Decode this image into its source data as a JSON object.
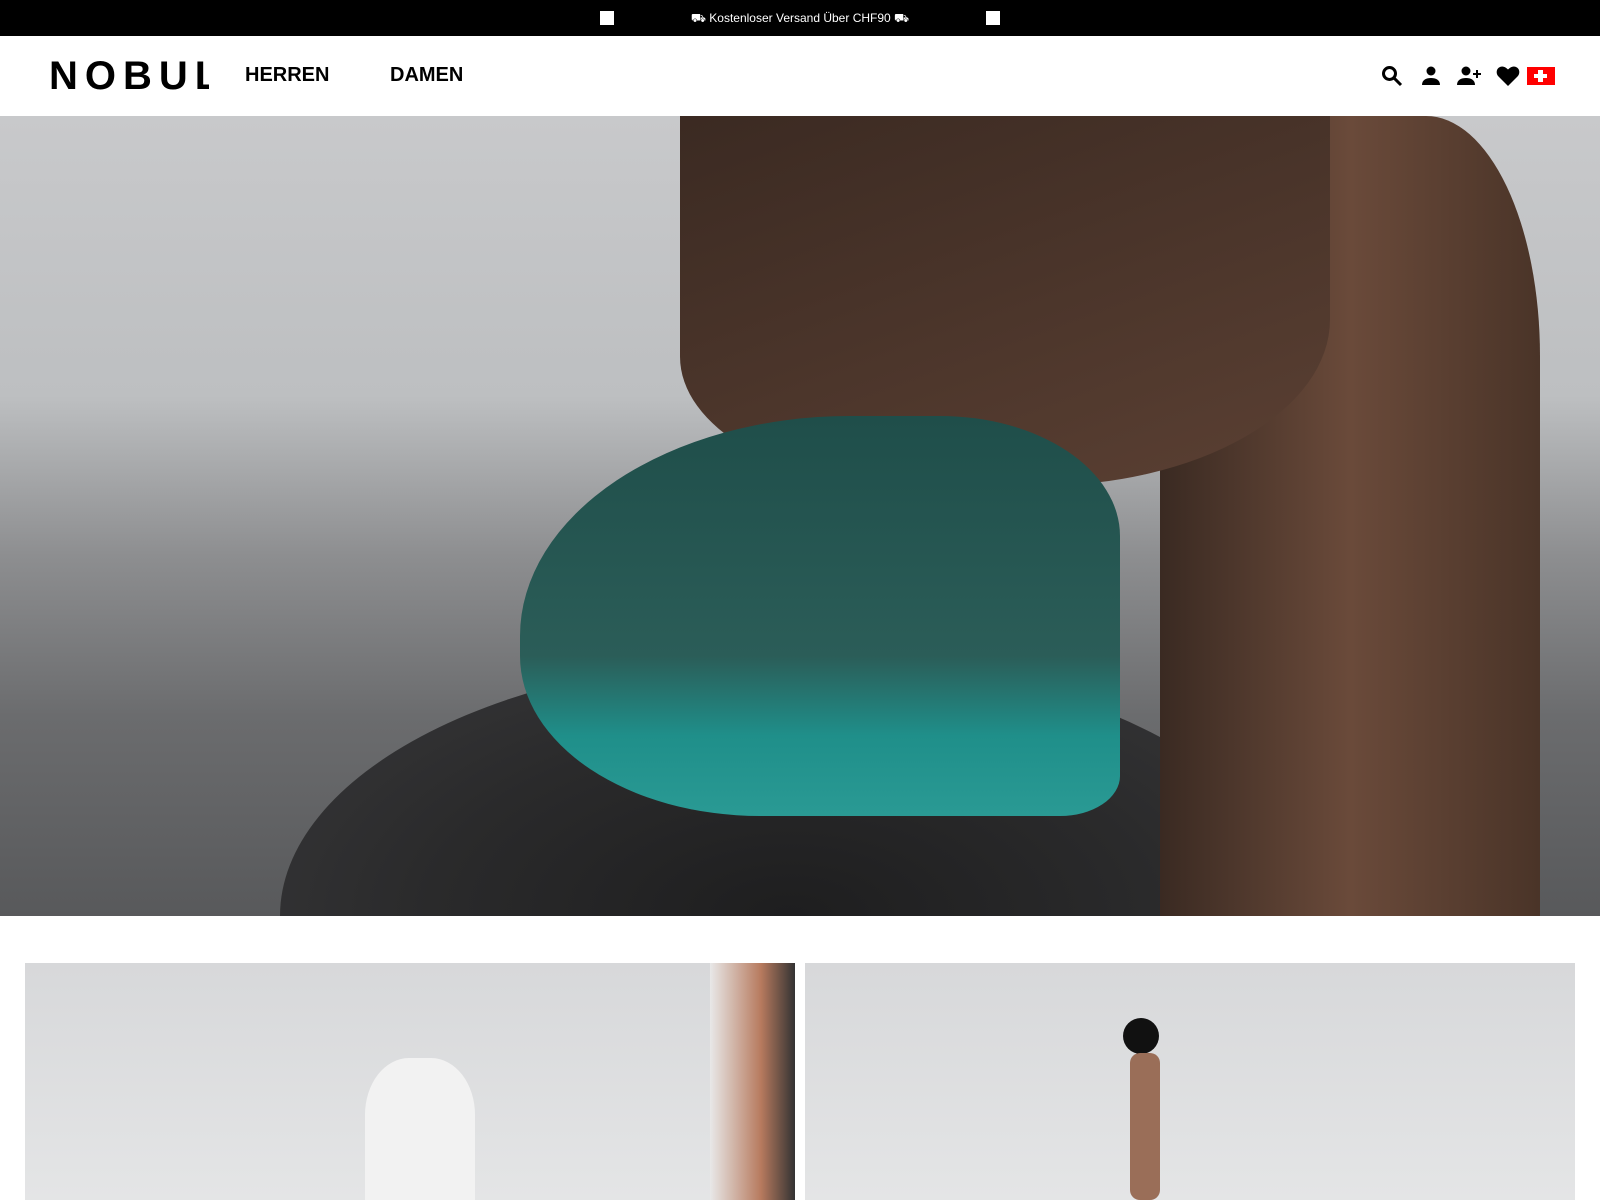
{
  "topbar": {
    "promo": "⛟ Kostenloser Versand Über CHF90 ⛟"
  },
  "header": {
    "logo": "NOBULL",
    "nav": [
      {
        "label": "HERREN"
      },
      {
        "label": "DAMEN"
      }
    ],
    "icons": [
      "search-icon",
      "user-icon",
      "add-user-icon",
      "heart-icon",
      "swiss-flag-icon"
    ]
  },
  "colors": {
    "shoe": "#1f8f8a",
    "flag": "#ff0000"
  }
}
